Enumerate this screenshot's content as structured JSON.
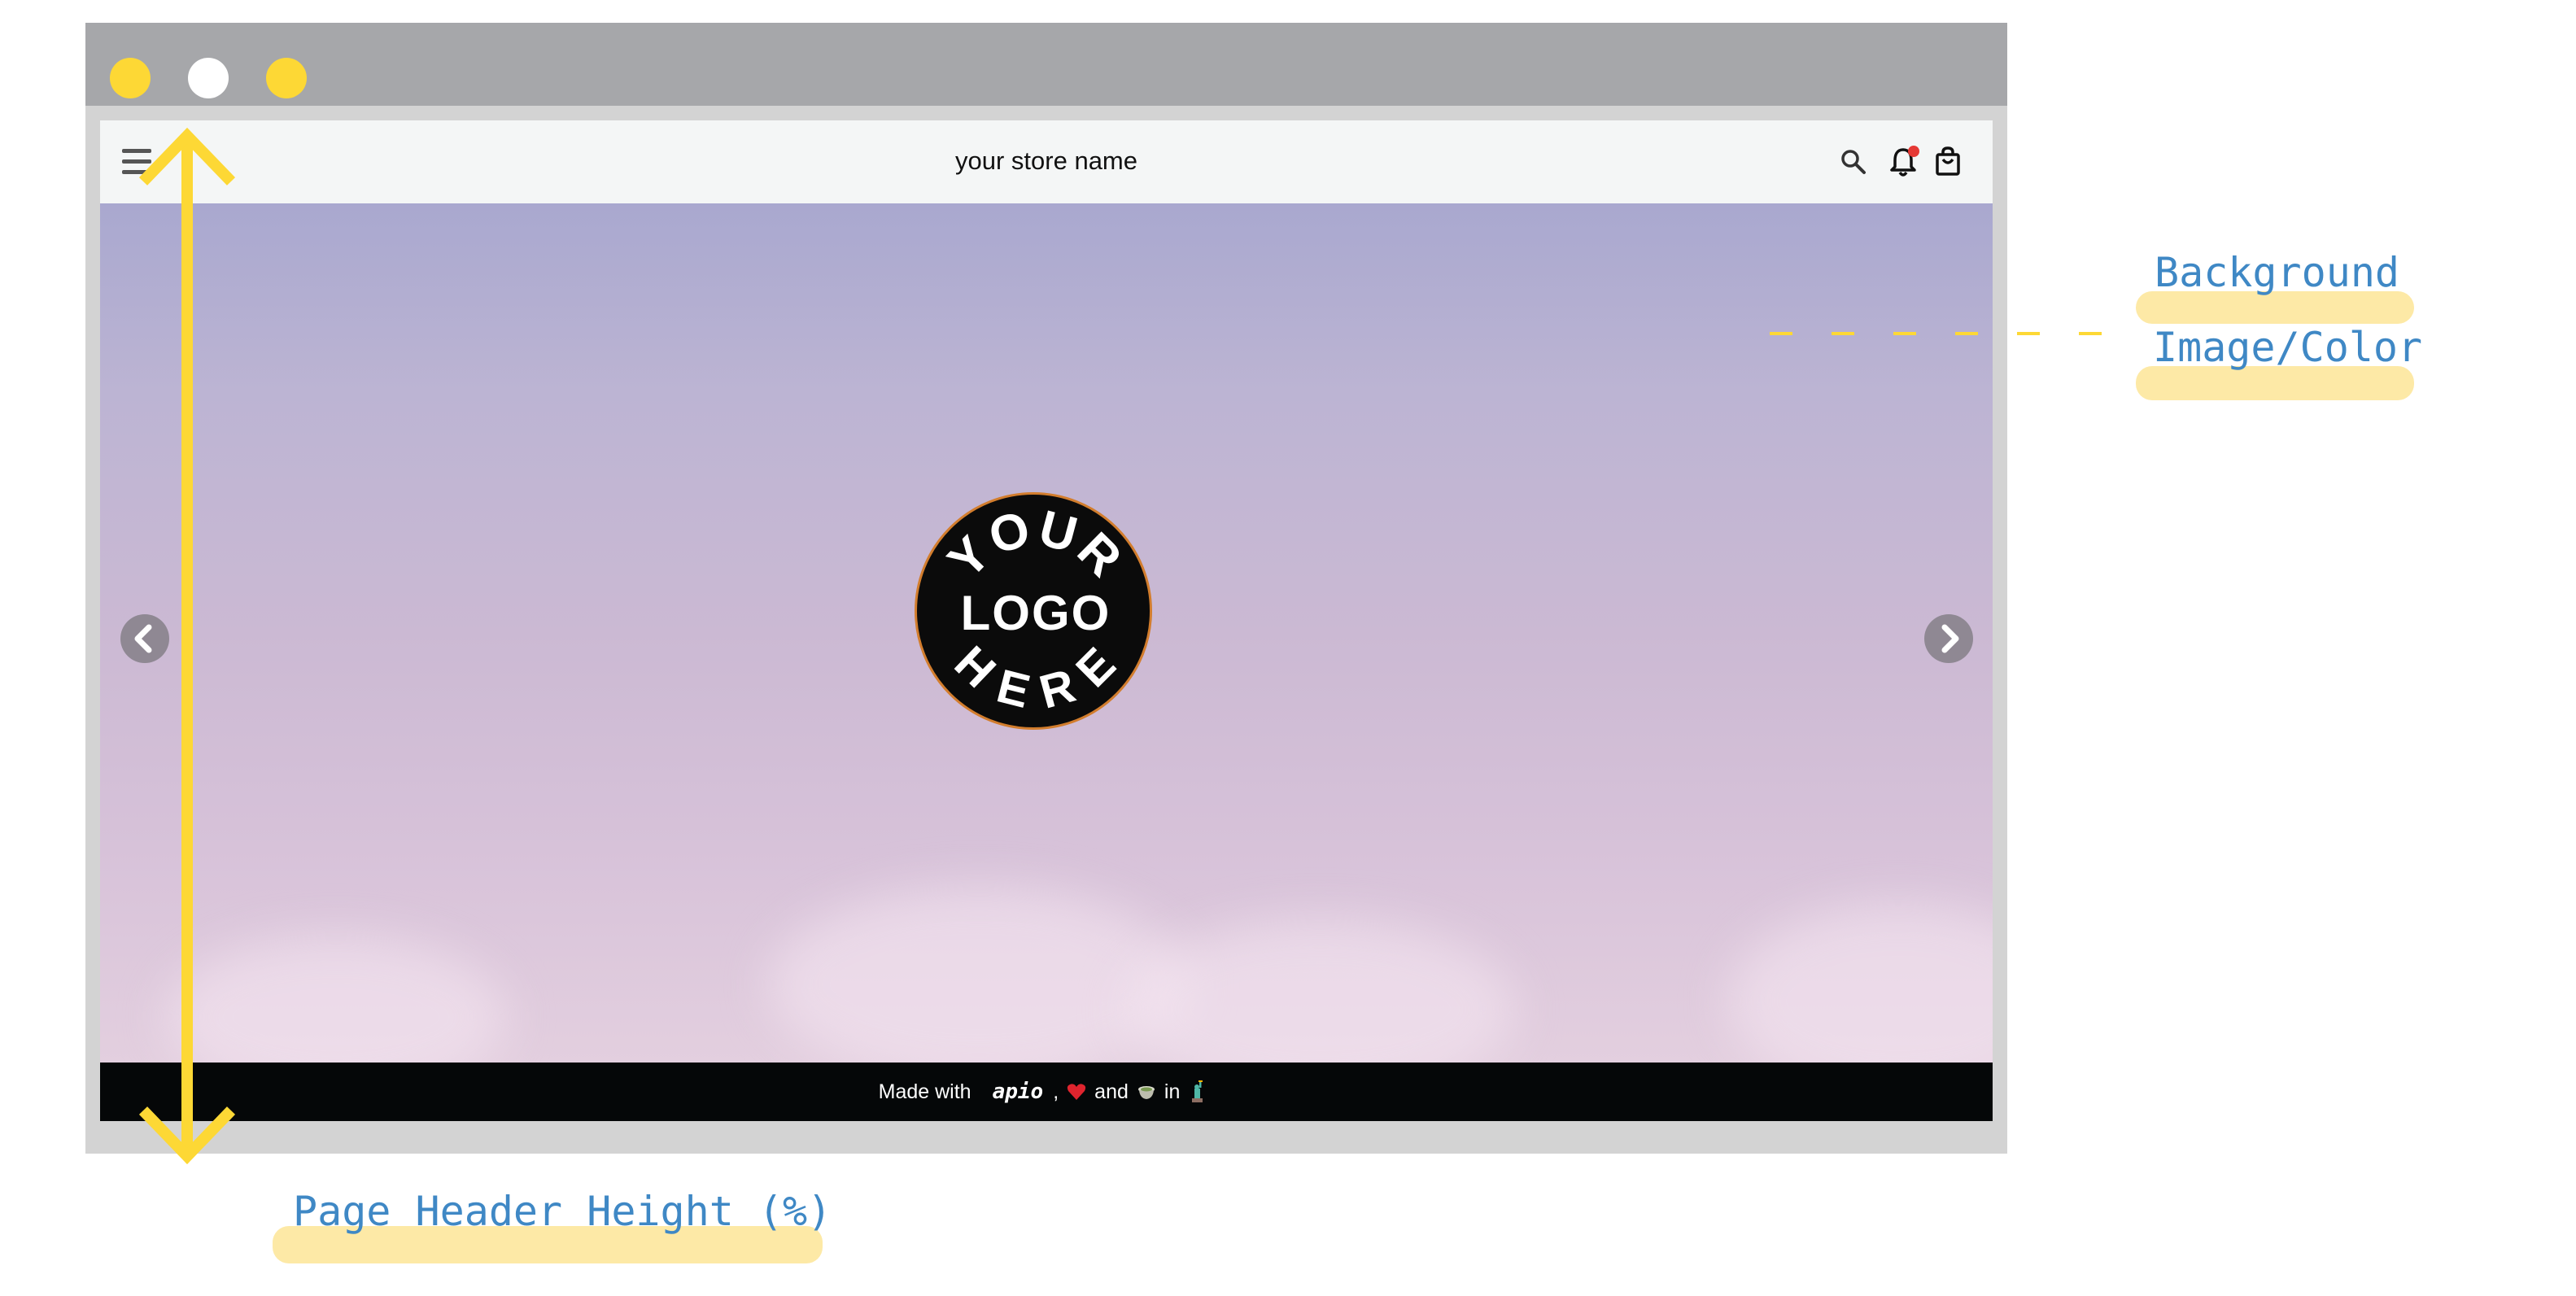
{
  "browser": {
    "traffic_lights": [
      "#fdd835",
      "#ffffff",
      "#fdd835"
    ]
  },
  "header": {
    "store_name": "your store name",
    "icons": [
      "menu-icon",
      "search-icon",
      "bell-icon",
      "shopping-bag-icon"
    ],
    "notification_badge_color": "#e53935"
  },
  "hero": {
    "logo_lines": [
      "YOUR",
      "LOGO",
      "HERE"
    ],
    "prev_icon": "chevron-left-icon",
    "next_icon": "chevron-right-icon"
  },
  "footer": {
    "made_with": "Made with",
    "brand": "apio",
    "separator": ",",
    "and": "and",
    "in": "in",
    "emojis": [
      "heart-icon",
      "matcha-cup-icon",
      "statue-of-liberty-icon"
    ]
  },
  "annotations": {
    "background_label_line1": "Background",
    "background_label_line2": "Image/Color",
    "header_height_label": "Page Header Height (%)"
  },
  "colors": {
    "accent_yellow": "#fdd835",
    "annotation_blue": "#3f88c5",
    "highlight": "#fde9a6",
    "footer_bg": "#050708"
  }
}
